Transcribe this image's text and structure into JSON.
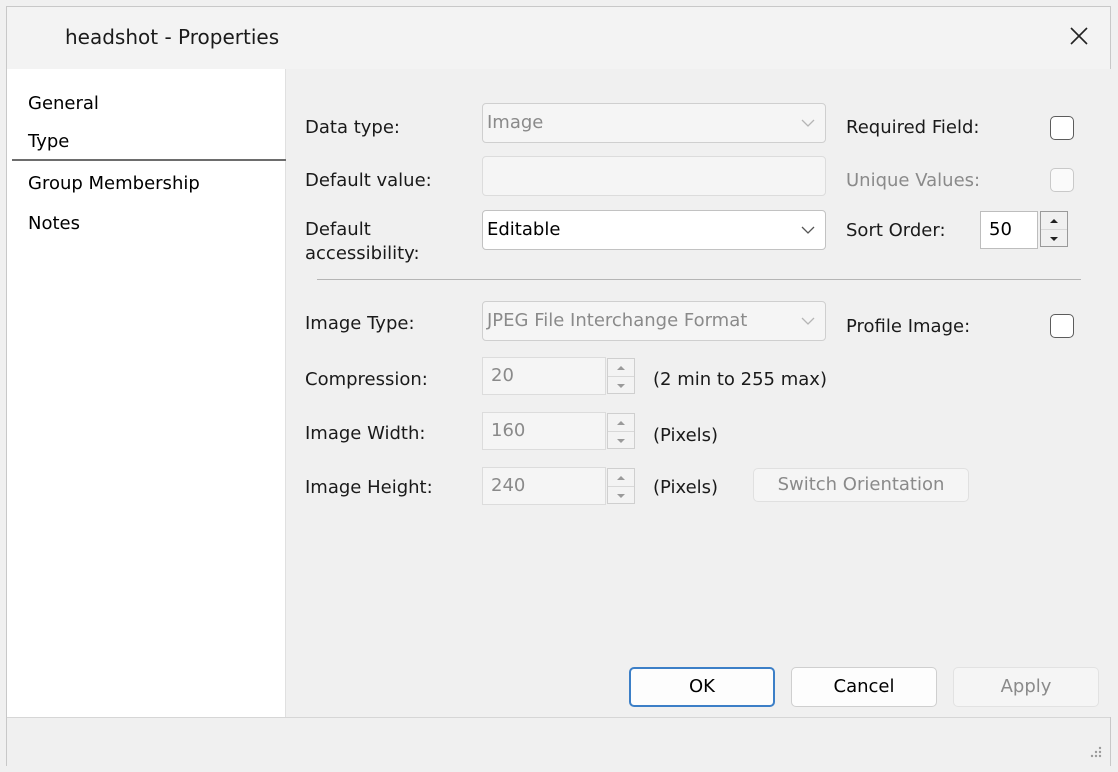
{
  "window": {
    "title": "headshot - Properties"
  },
  "nav": {
    "items": [
      {
        "label": "General"
      },
      {
        "label": "Type"
      },
      {
        "label": "Group Membership"
      },
      {
        "label": "Notes"
      }
    ],
    "selected": "Type"
  },
  "form": {
    "data_type": {
      "label": "Data type:",
      "value": "Image"
    },
    "required_field": {
      "label": "Required Field:"
    },
    "default_value": {
      "label": "Default value:",
      "value": ""
    },
    "unique_values": {
      "label": "Unique Values:"
    },
    "default_accessibility": {
      "label": "Default accessibility:",
      "value": "Editable"
    },
    "sort_order": {
      "label": "Sort Order:",
      "value": "50"
    },
    "image_type": {
      "label": "Image Type:",
      "value": "JPEG File Interchange Format"
    },
    "profile_image": {
      "label": "Profile Image:"
    },
    "compression": {
      "label": "Compression:",
      "value": "20",
      "hint": "(2 min to 255 max)"
    },
    "image_width": {
      "label": "Image Width:",
      "value": "160",
      "hint": "(Pixels)"
    },
    "image_height": {
      "label": "Image Height:",
      "value": "240",
      "hint": "(Pixels)"
    },
    "switch_orientation": {
      "label": "Switch Orientation"
    }
  },
  "buttons": {
    "ok": "OK",
    "cancel": "Cancel",
    "apply": "Apply"
  },
  "icons": {
    "close": "close-icon",
    "chevron": "chevron-down-icon",
    "grip": "resize-grip-icon"
  },
  "colors": {
    "default_button_border": "#3c7fc7",
    "disabled_text": "#8a8a8a"
  }
}
